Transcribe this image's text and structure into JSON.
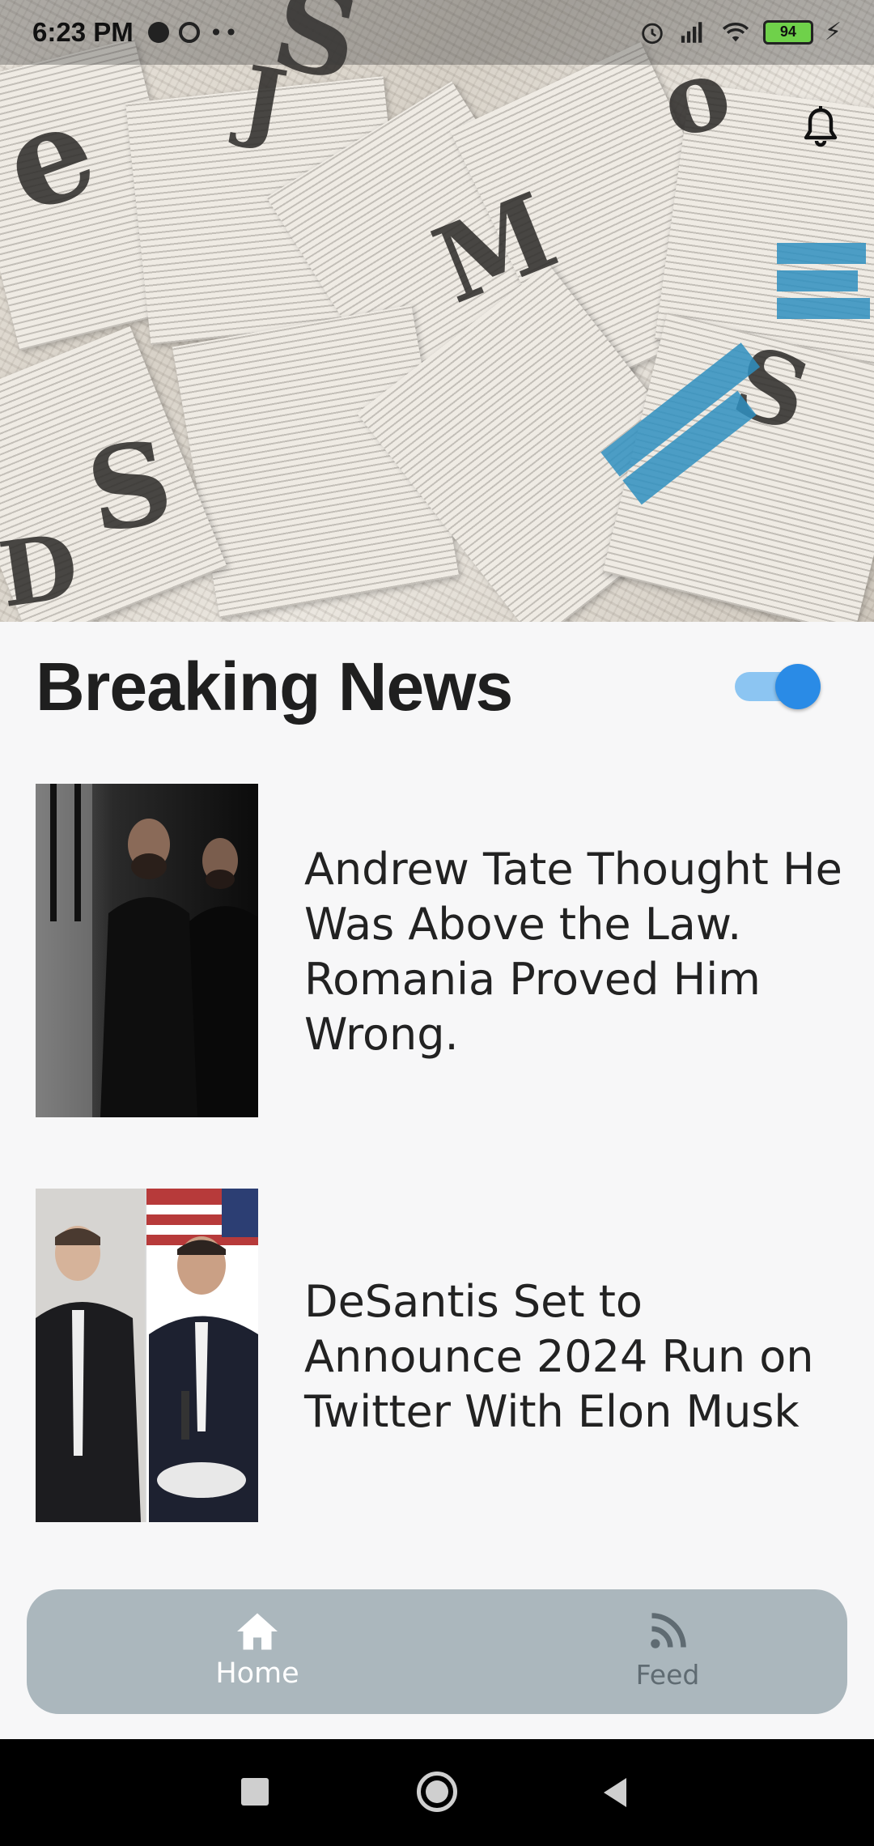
{
  "status_bar": {
    "time": "6:23 PM",
    "battery_level": "94"
  },
  "hero": {
    "image": "newspaper-collage",
    "notification_icon": "bell-icon"
  },
  "header": {
    "title": "Breaking News",
    "toggle_on": true
  },
  "news": [
    {
      "headline": "Andrew Tate Thought He Was Above the Law. Romania Proved Him Wrong.",
      "image": "two-men-dark-photo"
    },
    {
      "headline": "DeSantis Set to Announce 2024 Run on Twitter With Elon Musk",
      "image": "two-men-split-photo"
    }
  ],
  "bottom_nav": {
    "items": [
      {
        "label": "Home",
        "icon": "home-icon",
        "active": true
      },
      {
        "label": "Feed",
        "icon": "rss-icon",
        "active": false
      }
    ],
    "active_color": "#ffffff",
    "inactive_color": "#5f6b72"
  },
  "system_nav": {
    "buttons": [
      "recents",
      "home",
      "back"
    ]
  }
}
